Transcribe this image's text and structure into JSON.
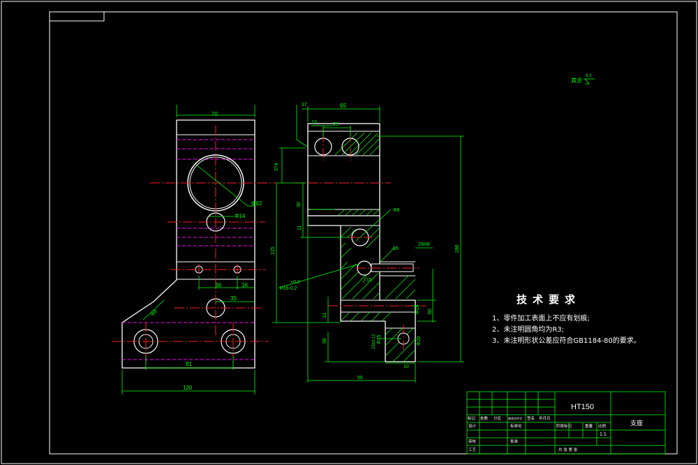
{
  "drawing": {
    "colors": {
      "outline": "#ffffff",
      "hatch": "#00ff00",
      "centerline": "#ff2020",
      "hidden": "#ff00ff",
      "dimension": "#00ff00",
      "background": "#000000"
    },
    "front_view": {
      "dims": {
        "width_top": "70",
        "width_bottom": "120",
        "hole_spacing": "81",
        "offset_36": "36",
        "offset_16": "16",
        "offset_35": "35",
        "bore_dia": "Φ62",
        "hole_dia": "Φ14",
        "chamfer": "Φ8"
      }
    },
    "side_view": {
      "dims": {
        "top_width": "65",
        "d13": "13",
        "d25": "25",
        "d37": "37",
        "d374": "374",
        "d30": "30",
        "d11": "11",
        "d125": "125",
        "d286": "286",
        "d8": "Φ8",
        "d65": "65",
        "groove": "25H8",
        "d16": "Φ16",
        "d60": "60",
        "d55": "55",
        "d96": "96",
        "d10": "10",
        "d11b": "11",
        "d15": "15",
        "tol_top": "+0.2",
        "tol_hole": "Φ16-0.2",
        "label_a": "Φ15",
        "label_b": "Φ20",
        "label_c": "23±0.12"
      }
    },
    "roughness": {
      "label": "其余",
      "value": "6.3"
    }
  },
  "technical_requirements": {
    "title": "技术要求",
    "items": [
      "1、零件加工表面上不应有划痕;",
      "2、未注明圆角均为R3;",
      "3、未注明形状公差应符合GB1184-80的要求。"
    ]
  },
  "title_block": {
    "material": "HT150",
    "part_name": "支座",
    "scale": "1:1",
    "labels": {
      "mark": "标记",
      "count": "处数",
      "zone": "分区",
      "change_doc": "更改文件号",
      "sign": "签名",
      "date": "年月日",
      "design": "设计",
      "standardize": "标准化",
      "review": "审核",
      "process": "工艺",
      "approve": "批准",
      "stage_mark": "阶段标记",
      "weight": "重量",
      "ratio": "比例",
      "sheets": "共 张 第 张"
    }
  }
}
